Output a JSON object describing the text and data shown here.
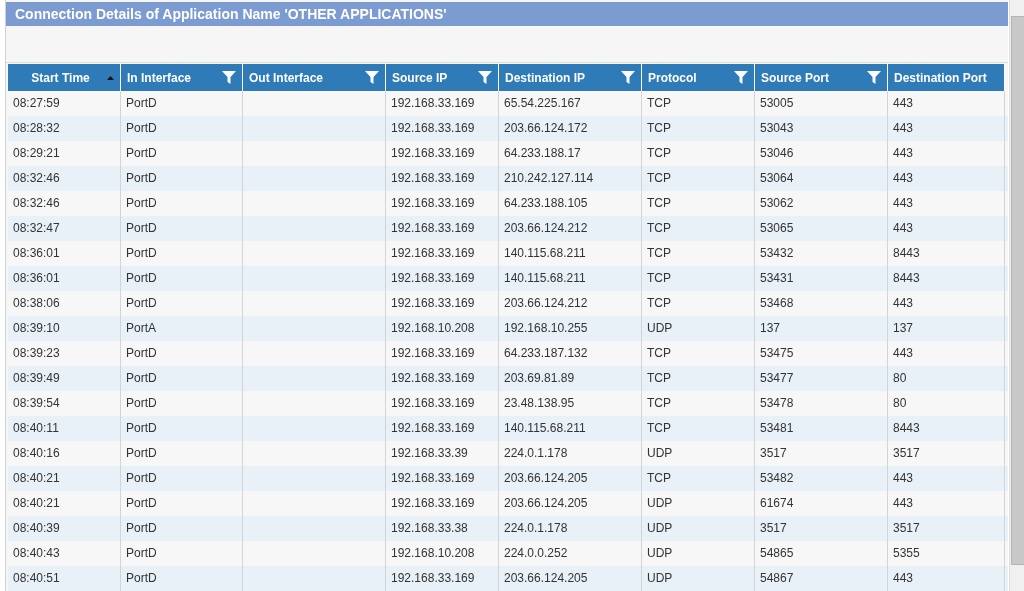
{
  "panel": {
    "title": "Connection Details of Application Name 'OTHER APPLICATIONS'"
  },
  "table": {
    "columns": [
      {
        "label": "Start Time",
        "sorted": true,
        "filter": false
      },
      {
        "label": "In Interface",
        "sorted": false,
        "filter": true
      },
      {
        "label": "Out Interface",
        "sorted": false,
        "filter": true
      },
      {
        "label": "Source IP",
        "sorted": false,
        "filter": true
      },
      {
        "label": "Destination IP",
        "sorted": false,
        "filter": true
      },
      {
        "label": "Protocol",
        "sorted": false,
        "filter": true
      },
      {
        "label": "Source Port",
        "sorted": false,
        "filter": true
      },
      {
        "label": "Destination Port",
        "sorted": false,
        "filter": false
      }
    ],
    "rows": [
      [
        "08:27:59",
        "PortD",
        "",
        "192.168.33.169",
        "65.54.225.167",
        "TCP",
        "53005",
        "443"
      ],
      [
        "08:28:32",
        "PortD",
        "",
        "192.168.33.169",
        "203.66.124.172",
        "TCP",
        "53043",
        "443"
      ],
      [
        "08:29:21",
        "PortD",
        "",
        "192.168.33.169",
        "64.233.188.17",
        "TCP",
        "53046",
        "443"
      ],
      [
        "08:32:46",
        "PortD",
        "",
        "192.168.33.169",
        "210.242.127.114",
        "TCP",
        "53064",
        "443"
      ],
      [
        "08:32:46",
        "PortD",
        "",
        "192.168.33.169",
        "64.233.188.105",
        "TCP",
        "53062",
        "443"
      ],
      [
        "08:32:47",
        "PortD",
        "",
        "192.168.33.169",
        "203.66.124.212",
        "TCP",
        "53065",
        "443"
      ],
      [
        "08:36:01",
        "PortD",
        "",
        "192.168.33.169",
        "140.115.68.211",
        "TCP",
        "53432",
        "8443"
      ],
      [
        "08:36:01",
        "PortD",
        "",
        "192.168.33.169",
        "140.115.68.211",
        "TCP",
        "53431",
        "8443"
      ],
      [
        "08:38:06",
        "PortD",
        "",
        "192.168.33.169",
        "203.66.124.212",
        "TCP",
        "53468",
        "443"
      ],
      [
        "08:39:10",
        "PortA",
        "",
        "192.168.10.208",
        "192.168.10.255",
        "UDP",
        "137",
        "137"
      ],
      [
        "08:39:23",
        "PortD",
        "",
        "192.168.33.169",
        "64.233.187.132",
        "TCP",
        "53475",
        "443"
      ],
      [
        "08:39:49",
        "PortD",
        "",
        "192.168.33.169",
        "203.69.81.89",
        "TCP",
        "53477",
        "80"
      ],
      [
        "08:39:54",
        "PortD",
        "",
        "192.168.33.169",
        "23.48.138.95",
        "TCP",
        "53478",
        "80"
      ],
      [
        "08:40:11",
        "PortD",
        "",
        "192.168.33.169",
        "140.115.68.211",
        "TCP",
        "53481",
        "8443"
      ],
      [
        "08:40:16",
        "PortD",
        "",
        "192.168.33.39",
        "224.0.1.178",
        "UDP",
        "3517",
        "3517"
      ],
      [
        "08:40:21",
        "PortD",
        "",
        "192.168.33.169",
        "203.66.124.205",
        "TCP",
        "53482",
        "443"
      ],
      [
        "08:40:21",
        "PortD",
        "",
        "192.168.33.169",
        "203.66.124.205",
        "UDP",
        "61674",
        "443"
      ],
      [
        "08:40:39",
        "PortD",
        "",
        "192.168.33.38",
        "224.0.1.178",
        "UDP",
        "3517",
        "3517"
      ],
      [
        "08:40:43",
        "PortD",
        "",
        "192.168.10.208",
        "224.0.0.252",
        "UDP",
        "54865",
        "5355"
      ],
      [
        "08:40:51",
        "PortD",
        "",
        "192.168.33.169",
        "203.66.124.205",
        "UDP",
        "54867",
        "443"
      ]
    ]
  }
}
